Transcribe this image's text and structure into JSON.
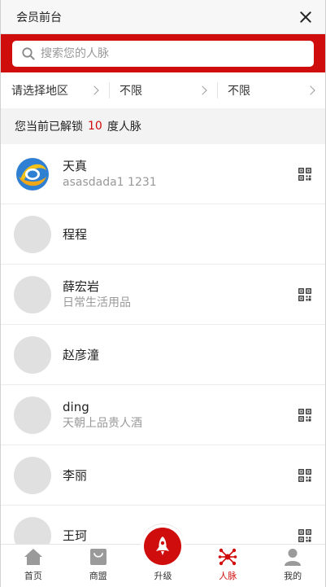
{
  "window": {
    "title": "会员前台"
  },
  "search": {
    "placeholder": "搜索您的人脉"
  },
  "filters": [
    {
      "label": "请选择地区"
    },
    {
      "label": "不限"
    },
    {
      "label": "不限"
    }
  ],
  "unlock": {
    "prefix": "您当前已解锁",
    "level": "10",
    "suffix": "度人脉"
  },
  "contacts": [
    {
      "name": "天真",
      "subtitle": "asasdada1 1231",
      "has_logo": true,
      "has_qr": true
    },
    {
      "name": "程程",
      "subtitle": "",
      "has_logo": false,
      "has_qr": false
    },
    {
      "name": "薛宏岩",
      "subtitle": "日常生活用品",
      "has_logo": false,
      "has_qr": true
    },
    {
      "name": "赵彦潼",
      "subtitle": "",
      "has_logo": false,
      "has_qr": false
    },
    {
      "name": "ding",
      "subtitle": "天朝上品贵人酒",
      "has_logo": false,
      "has_qr": true
    },
    {
      "name": "李丽",
      "subtitle": "",
      "has_logo": false,
      "has_qr": true
    },
    {
      "name": "王珂",
      "subtitle": "",
      "has_logo": false,
      "has_qr": true
    }
  ],
  "tabbar": [
    {
      "label": "首页",
      "icon": "home-icon"
    },
    {
      "label": "商盟",
      "icon": "shop-bag-icon"
    },
    {
      "label": "升级",
      "icon": "rocket-icon"
    },
    {
      "label": "人脉",
      "icon": "network-icon",
      "active": true
    },
    {
      "label": "我的",
      "icon": "user-icon"
    }
  ],
  "colors": {
    "brand": "#d00d0d",
    "muted": "#999999"
  }
}
